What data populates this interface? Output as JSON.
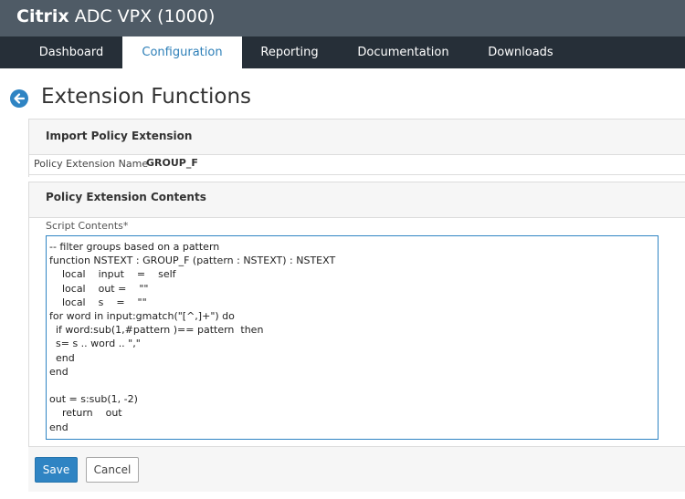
{
  "app": {
    "brand_bold": "Citrix",
    "brand_rest": " ADC VPX (1000)"
  },
  "nav": {
    "tabs": [
      {
        "label": "Dashboard",
        "active": false
      },
      {
        "label": "Configuration",
        "active": true
      },
      {
        "label": "Reporting",
        "active": false
      },
      {
        "label": "Documentation",
        "active": false
      },
      {
        "label": "Downloads",
        "active": false
      }
    ]
  },
  "page": {
    "title": "Extension Functions",
    "back_icon": "arrow-left-circle-icon"
  },
  "import_section": {
    "title": "Import Policy Extension",
    "name_label": "Policy Extension Name",
    "name_value": "GROUP_F"
  },
  "contents_section": {
    "title": "Policy Extension Contents",
    "script_label": "Script Contents*",
    "script_value": "-- filter groups based on a pattern\nfunction NSTEXT : GROUP_F (pattern : NSTEXT) : NSTEXT\n    local    input    =    self\n    local    out =    \"\"\n    local    s    =    \"\"\nfor word in input:gmatch(\"[^,]+\") do\n  if word:sub(1,#pattern )== pattern  then\n  s= s .. word .. \",\"\n  end\nend\n\nout = s:sub(1, -2)\n    return    out\nend"
  },
  "actions": {
    "save_label": "Save",
    "cancel_label": "Cancel"
  },
  "colors": {
    "accent": "#2f84c3",
    "topbar": "#4f5b66",
    "navbar": "#262f38"
  }
}
